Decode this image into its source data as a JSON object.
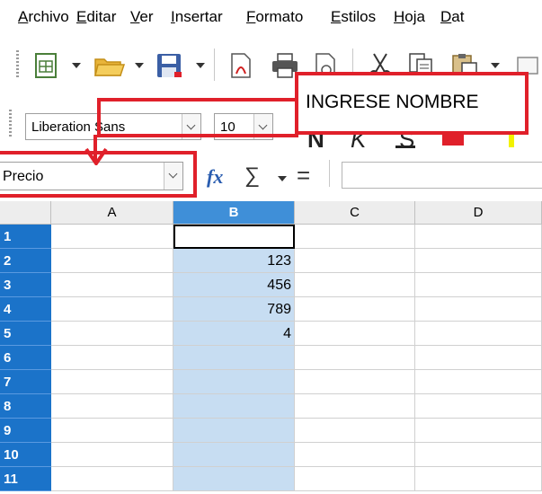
{
  "menu": {
    "items": [
      {
        "first": "A",
        "rest": "rchivo"
      },
      {
        "first": "E",
        "rest": "ditar"
      },
      {
        "first": "V",
        "rest": "er"
      },
      {
        "first": "I",
        "rest": "nsertar"
      },
      {
        "first": "F",
        "rest": "ormato"
      },
      {
        "first": "E",
        "rest": "stilos"
      },
      {
        "first": "H",
        "rest": "oja"
      },
      {
        "first": "D",
        "rest": "at"
      }
    ]
  },
  "formatting": {
    "font_name": "Liberation Sans",
    "font_size": "10",
    "annotation_text": "INGRESE NOMBRE"
  },
  "formula_bar": {
    "name_box": "Precio",
    "fx_label": "fx",
    "sum_symbol": "∑",
    "equals_symbol": "="
  },
  "grid": {
    "columns": [
      "A",
      "B",
      "C",
      "D"
    ],
    "selected_column": "B",
    "rows": [
      "1",
      "2",
      "3",
      "4",
      "5",
      "6",
      "7",
      "8",
      "9",
      "10",
      "11"
    ],
    "column_b_values": [
      "",
      "123",
      "456",
      "789",
      "4",
      "",
      "",
      "",
      "",
      "",
      ""
    ]
  },
  "colors": {
    "annotation_red": "#e0202a",
    "selection_blue": "#1b73c9",
    "selected_cell_bg": "#c7ddf2",
    "highlight_yellow": "#f2f200"
  }
}
